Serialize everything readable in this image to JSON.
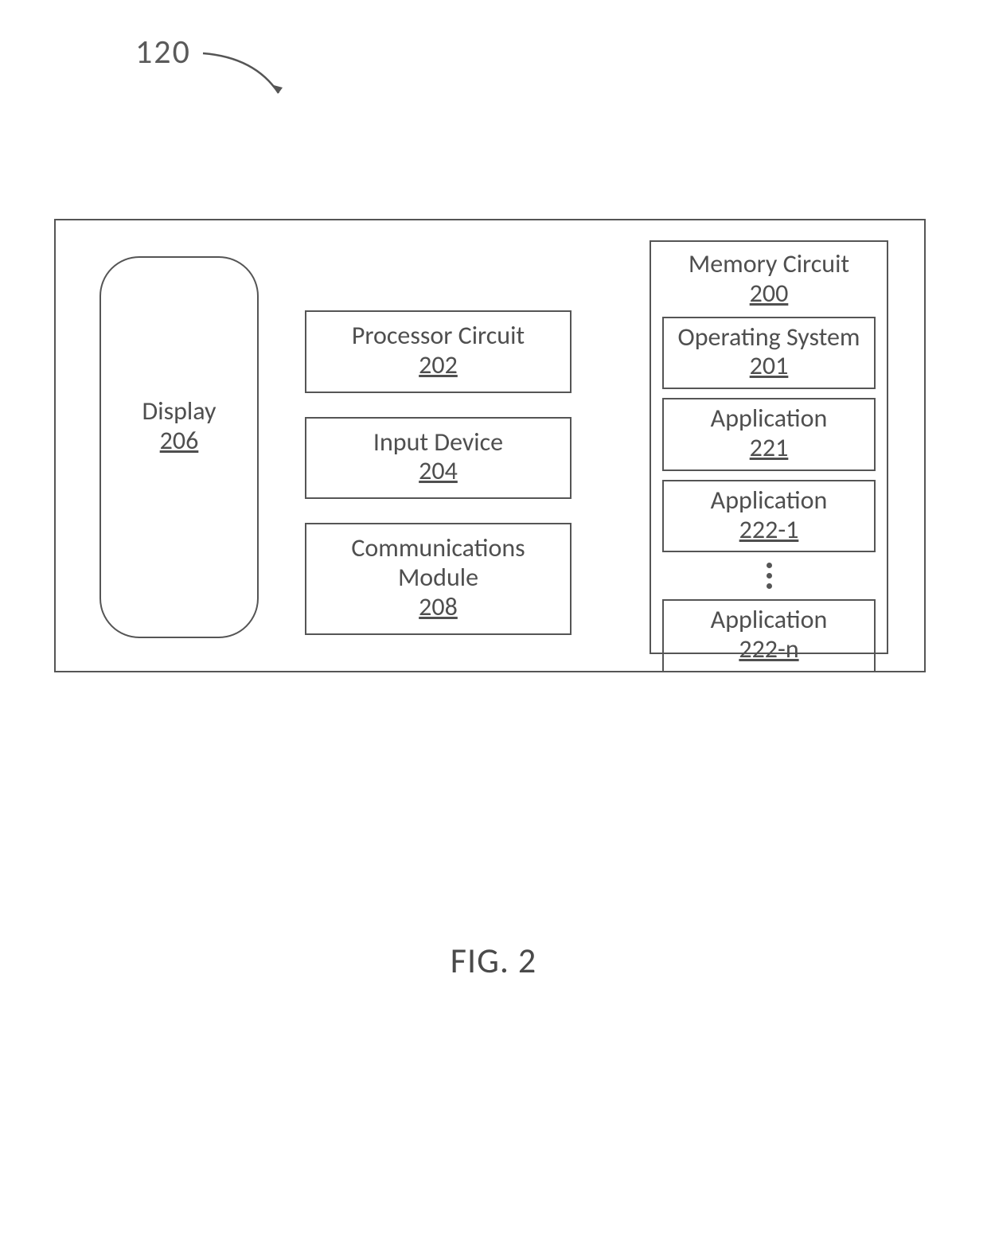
{
  "figure": {
    "ref_number": "120",
    "caption": "FIG. 2"
  },
  "display": {
    "label": "Display",
    "ref": "206"
  },
  "center": {
    "processor": {
      "label": "Processor Circuit",
      "ref": "202"
    },
    "input": {
      "label": "Input Device",
      "ref": "204"
    },
    "comms": {
      "label": "Communications Module",
      "ref": "208"
    }
  },
  "memory": {
    "label": "Memory Circuit",
    "ref": "200",
    "items": {
      "os": {
        "label": "Operating System",
        "ref": "201"
      },
      "app0": {
        "label": "Application",
        "ref": "221"
      },
      "app1": {
        "label": "Application",
        "ref": "222-1"
      },
      "appn": {
        "label": "Application",
        "ref": "222-n"
      }
    }
  }
}
